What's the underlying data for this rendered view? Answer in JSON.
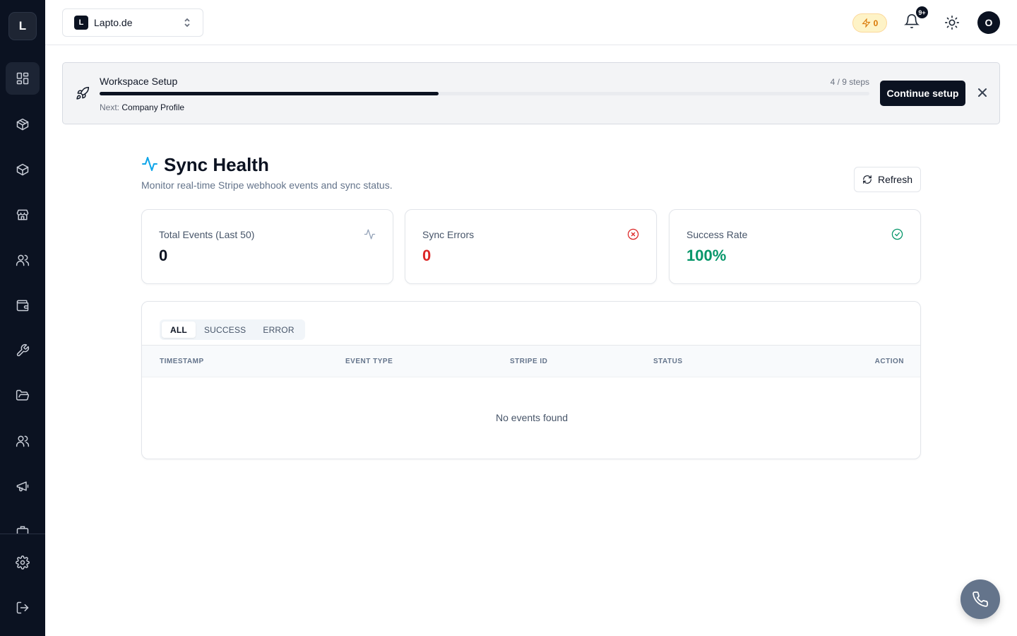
{
  "app": {
    "logo_letter": "L"
  },
  "sidebar": {
    "items": [
      {
        "icon": "dashboard-icon",
        "active": true
      },
      {
        "icon": "package-icon",
        "active": false
      },
      {
        "icon": "box-icon",
        "active": false
      },
      {
        "icon": "store-icon",
        "active": false
      },
      {
        "icon": "users-icon",
        "active": false
      },
      {
        "icon": "wallet-icon",
        "active": false
      },
      {
        "icon": "wrench-icon",
        "active": false
      },
      {
        "icon": "folder-icon",
        "active": false
      },
      {
        "icon": "team-icon",
        "active": false
      },
      {
        "icon": "megaphone-icon",
        "active": false
      }
    ],
    "footer": [
      {
        "icon": "settings-icon"
      },
      {
        "icon": "logout-icon"
      }
    ]
  },
  "header": {
    "workspace": {
      "initial": "L",
      "name": "Lapto.de"
    },
    "credits": "0",
    "notifications_badge": "9+",
    "user_initial": "O"
  },
  "setup": {
    "title": "Workspace Setup",
    "steps": "4 / 9 steps",
    "progress_fraction": 0.44,
    "next_label": "Next:",
    "next_value": "Company Profile",
    "button": "Continue setup"
  },
  "page": {
    "title": "Sync Health",
    "subtitle": "Monitor real-time Stripe webhook events and sync status.",
    "refresh": "Refresh"
  },
  "stats": [
    {
      "label": "Total Events (Last 50)",
      "value": "0",
      "color": "#0b1221",
      "icon": "activity-icon"
    },
    {
      "label": "Sync Errors",
      "value": "0",
      "color": "#dc2626",
      "icon": "x-circle-icon"
    },
    {
      "label": "Success Rate",
      "value": "100%",
      "color": "#059669",
      "icon": "check-circle-icon"
    }
  ],
  "events": {
    "tabs": [
      "ALL",
      "SUCCESS",
      "ERROR"
    ],
    "active_tab": "ALL",
    "columns": [
      "TIMESTAMP",
      "EVENT TYPE",
      "STRIPE ID",
      "STATUS",
      "ACTION"
    ],
    "rows": [],
    "empty_text": "No events found"
  },
  "colors": {
    "sidebar_bg": "#0b1221",
    "accent_icon": "#0ea5e9",
    "error": "#dc2626",
    "success": "#059669",
    "credit": "#d97706",
    "fab": "#64748b"
  }
}
